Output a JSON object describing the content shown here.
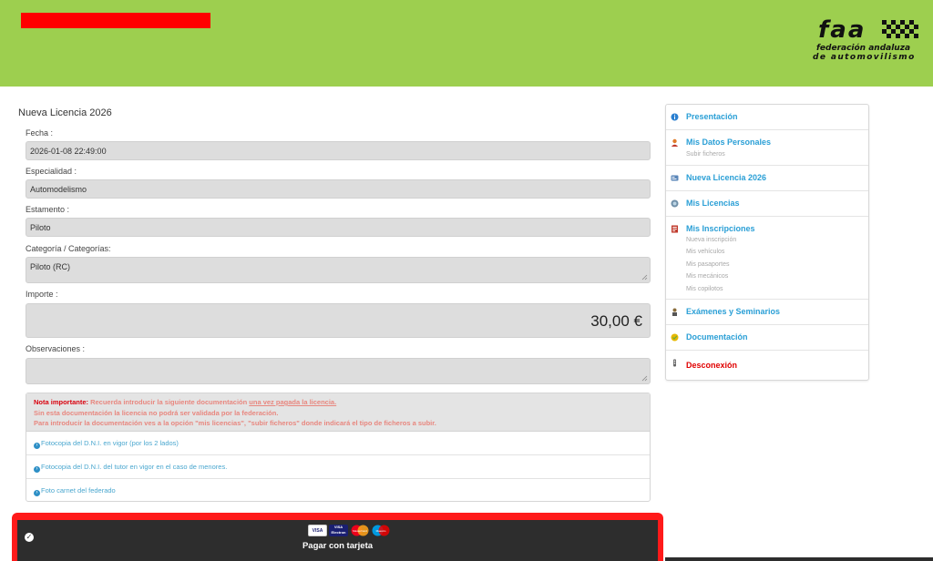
{
  "header": {
    "logo": {
      "word": "faa",
      "line1": "federación andaluza",
      "line2": "de automovilismo"
    },
    "colors": {
      "header_bg": "#9dcf4f",
      "redacted": "#ff0000"
    }
  },
  "form": {
    "title": "Nueva Licencia 2026",
    "fecha_label": "Fecha :",
    "fecha_value": "2026-01-08 22:49:00",
    "especialidad_label": "Especialidad :",
    "especialidad_value": "Automodelismo",
    "estamento_label": "Estamento :",
    "estamento_value": "Piloto",
    "categoria_label": "Categoría / Categorías:",
    "categoria_value": "Piloto (RC)",
    "importe_label": "Importe :",
    "importe_value": "30,00 €",
    "observaciones_label": "Observaciones :",
    "observaciones_value": ""
  },
  "note": {
    "strong": "Nota importante:",
    "line1_a": " Recuerda introducir la siguiente documentación ",
    "line1_u": "una vez pagada la licencia.",
    "line2": "Sin esta documentación la licencia no podrá ser validada por la federación.",
    "line3": "Para introducir la documentación ves a la opción \"mis licencias\", \"subir ficheros\" donde indicará el tipo de ficheros a subir.",
    "docs": [
      "Fotocopia del D.N.I. en vigor (por los 2 lados)",
      "Fotocopia del D.N.I. del tutor en vigor en el caso de menores.",
      "Foto carnet del federado"
    ]
  },
  "payment": {
    "label": "Pagar con tarjeta",
    "cards": [
      "VISA",
      "VISA Electron",
      "MasterCard",
      "Maestro"
    ]
  },
  "sidebar": {
    "items": [
      {
        "label": "Presentación",
        "icon": "info-icon",
        "subs": []
      },
      {
        "label": "Mis Datos Personales",
        "icon": "user-icon",
        "subs": [
          "Subir ficheros"
        ]
      },
      {
        "label": "Nueva Licencia 2026",
        "icon": "license-card-icon",
        "subs": []
      },
      {
        "label": "Mis Licencias",
        "icon": "licenses-icon",
        "subs": []
      },
      {
        "label": "Mis Inscripciones",
        "icon": "inscriptions-icon",
        "subs": [
          "Nueva inscripción",
          "Mis vehículos",
          "Mis pasaportes",
          "Mis mecánicos",
          "Mis copilotos"
        ]
      },
      {
        "label": "Exámenes y Seminarios",
        "icon": "exam-icon",
        "subs": []
      },
      {
        "label": "Documentación",
        "icon": "document-icon",
        "subs": []
      },
      {
        "label": "Desconexión",
        "icon": "logout-icon",
        "subs": []
      }
    ]
  }
}
